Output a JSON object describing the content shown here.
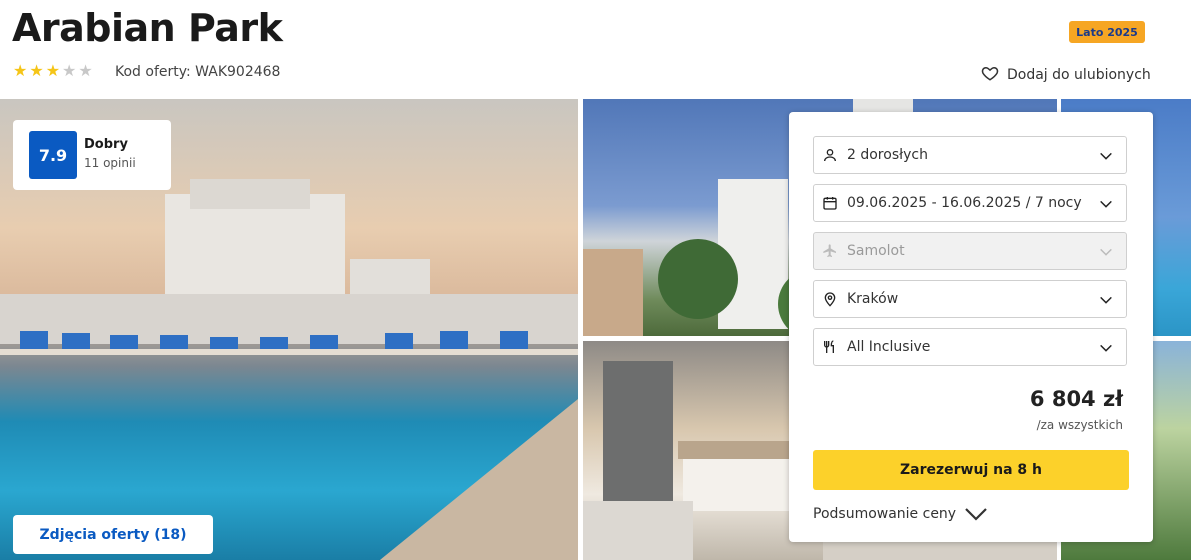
{
  "hotel": {
    "name": "Arabian Park",
    "stars_filled": 3,
    "stars_total": 5,
    "offer_code": "Kod oferty: WAK902468"
  },
  "season_badge": "Lato 2025",
  "favorite_label": "Dodaj do ulubionych",
  "rating": {
    "score": "7.9",
    "label": "Dobry",
    "count": "11 opinii"
  },
  "photos_button": "Zdjęcia oferty (18)",
  "booking": {
    "travelers": "2 dorosłych",
    "dates": "09.06.2025 - 16.06.2025 / 7 nocy",
    "transport": "Samolot",
    "departure": "Kraków",
    "board": "All Inclusive",
    "price": "6 804 zł",
    "price_note": "/za wszystkich",
    "book_button": "Zarezerwuj na 8 h",
    "summary_label": "Podsumowanie ceny"
  },
  "colors": {
    "accent_blue": "#0a5ac2",
    "cta_yellow": "#fcd12a",
    "badge_orange": "#f6a623",
    "star_gold": "#f5c518"
  }
}
